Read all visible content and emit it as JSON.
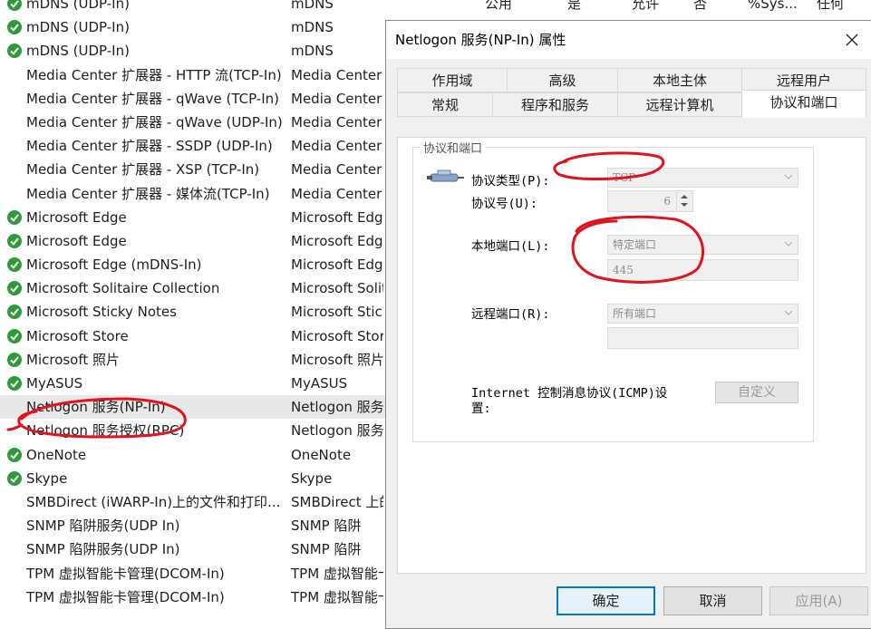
{
  "rules": [
    {
      "enabled": true,
      "name": "mDNS (UDP-In)",
      "group": "mDNS",
      "profile": "公用",
      "enabled_text": "是",
      "action": "允许",
      "override": "否",
      "program": "%Sys...",
      "local_address": "任何"
    },
    {
      "enabled": true,
      "name": "mDNS (UDP-In)",
      "group": "mDNS"
    },
    {
      "enabled": true,
      "name": "mDNS (UDP-In)",
      "group": "mDNS"
    },
    {
      "enabled": false,
      "name": "Media Center 扩展器 - HTTP 流(TCP-In)",
      "group": "Media Center 扩"
    },
    {
      "enabled": false,
      "name": "Media Center 扩展器 - qWave (TCP-In)",
      "group": "Media Center 扩"
    },
    {
      "enabled": false,
      "name": "Media Center 扩展器 - qWave (UDP-In)",
      "group": "Media Center 扩"
    },
    {
      "enabled": false,
      "name": "Media Center 扩展器 - SSDP (UDP-In)",
      "group": "Media Center 扩"
    },
    {
      "enabled": false,
      "name": "Media Center 扩展器 - XSP (TCP-In)",
      "group": "Media Center 扩"
    },
    {
      "enabled": false,
      "name": "Media Center 扩展器 - 媒体流(TCP-In)",
      "group": "Media Center 扩"
    },
    {
      "enabled": true,
      "name": "Microsoft Edge",
      "group": "Microsoft Edge"
    },
    {
      "enabled": true,
      "name": "Microsoft Edge",
      "group": "Microsoft Edge"
    },
    {
      "enabled": true,
      "name": "Microsoft Edge (mDNS-In)",
      "group": "Microsoft Edge"
    },
    {
      "enabled": true,
      "name": "Microsoft Solitaire Collection",
      "group": "Microsoft Solita"
    },
    {
      "enabled": true,
      "name": "Microsoft Sticky Notes",
      "group": "Microsoft Sticky"
    },
    {
      "enabled": true,
      "name": "Microsoft Store",
      "group": "Microsoft Store"
    },
    {
      "enabled": true,
      "name": "Microsoft 照片",
      "group": "Microsoft 照片"
    },
    {
      "enabled": true,
      "name": "MyASUS",
      "group": "MyASUS"
    },
    {
      "enabled": false,
      "name": "Netlogon 服务(NP-In)",
      "group": "Netlogon 服务",
      "selected": true
    },
    {
      "enabled": false,
      "name": "Netlogon 服务授权(RPC)",
      "group": "Netlogon 服务"
    },
    {
      "enabled": true,
      "name": "OneNote",
      "group": "OneNote"
    },
    {
      "enabled": true,
      "name": "Skype",
      "group": "Skype"
    },
    {
      "enabled": false,
      "name": "SMBDirect (iWARP-In)上的文件和打印...",
      "group": "SMBDirect 上的"
    },
    {
      "enabled": false,
      "name": "SNMP 陷阱服务(UDP In)",
      "group": "SNMP 陷阱"
    },
    {
      "enabled": false,
      "name": "SNMP 陷阱服务(UDP In)",
      "group": "SNMP 陷阱"
    },
    {
      "enabled": false,
      "name": "TPM 虚拟智能卡管理(DCOM-In)",
      "group": "TPM 虚拟智能卡"
    },
    {
      "enabled": false,
      "name": "TPM 虚拟智能卡管理(DCOM-In)",
      "group": "TPM 虚拟智能卡"
    }
  ],
  "dialog": {
    "title": "Netlogon 服务(NP-In) 属性",
    "tabs_row1": [
      "作用域",
      "高级",
      "本地主体",
      "远程用户"
    ],
    "tabs_row2": [
      "常规",
      "程序和服务",
      "远程计算机",
      "协议和端口"
    ],
    "active_tab": "协议和端口",
    "group_title": "协议和端口",
    "protocol_type_label": "协议类型(P):",
    "protocol_type_value": "TCP",
    "protocol_number_label": "协议号(U):",
    "protocol_number_value": "6",
    "local_port_label": "本地端口(L):",
    "local_port_value": "特定端口",
    "local_port_number": "445",
    "remote_port_label": "远程端口(R):",
    "remote_port_value": "所有端口",
    "remote_port_number": "",
    "icmp_label_line1": "Internet 控制消息协议(ICMP)设",
    "icmp_label_line2": "置:",
    "customize_button": "自定义",
    "ok_button": "确定",
    "cancel_button": "取消",
    "apply_button": "应用(A)"
  },
  "colors": {
    "check_green": "#2e9a3a",
    "annotation_red": "#e0141e",
    "default_button_border": "#0078d7"
  }
}
